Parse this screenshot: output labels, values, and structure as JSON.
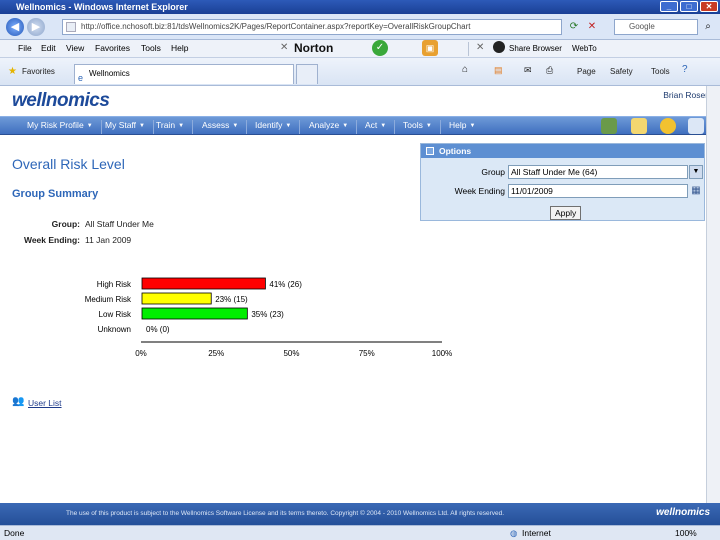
{
  "window": {
    "title": "Wellnomics - Windows Internet Explorer",
    "address": "http://office.nchosoft.biz:81/tdsWellnomics2K/Pages/ReportContainer.aspx?reportKey=OverallRiskGroupChart",
    "search_placeholder": "Google"
  },
  "menu": [
    "File",
    "Edit",
    "View",
    "Favorites",
    "Tools",
    "Help"
  ],
  "toolbar": {
    "norton": "Norton",
    "share_browser": "Share Browser",
    "web_to": "WebTo"
  },
  "favorites_bar": {
    "favorites": "Favorites",
    "tab": "Wellnomics",
    "page": "Page",
    "safety": "Safety",
    "tools": "Tools"
  },
  "app": {
    "logo": "wellnomics",
    "user": "Brian Rosen",
    "nav": [
      "My Risk Profile",
      "My Staff",
      "Train",
      "Assess",
      "Identify",
      "Analyze",
      "Act",
      "Tools",
      "Help"
    ]
  },
  "report": {
    "title": "Overall Risk Level",
    "subtitle": "Group Summary",
    "group_label": "Group:",
    "group_value": "All Staff Under Me",
    "week_label": "Week Ending:",
    "week_value": "11 Jan 2009",
    "user_list": "User List"
  },
  "options": {
    "header": "Options",
    "group_label": "Group",
    "group_value": "All Staff Under Me (64)",
    "week_label": "Week Ending",
    "week_value": "11/01/2009",
    "apply": "Apply"
  },
  "chart_data": {
    "type": "bar",
    "orientation": "horizontal",
    "categories": [
      "High Risk",
      "Medium Risk",
      "Low Risk",
      "Unknown"
    ],
    "values": [
      41,
      23,
      35,
      0
    ],
    "counts": [
      26,
      15,
      23,
      0
    ],
    "data_labels": [
      "41% (26)",
      "23% (15)",
      "35% (23)",
      "0% (0)"
    ],
    "colors": [
      "#ff0000",
      "#ffff00",
      "#00ee00",
      "#cccccc"
    ],
    "xlim": [
      0,
      100
    ],
    "xticks": [
      "0%",
      "25%",
      "50%",
      "75%",
      "100%"
    ]
  },
  "footer": {
    "text": "The use of this product is subject to the Wellnomics Software License and its terms thereto. Copyright © 2004 - 2010 Wellnomics Ltd. All rights reserved.",
    "logo": "wellnomics"
  },
  "status": {
    "left": "Done",
    "zone": "Internet",
    "zoom": "100%"
  }
}
